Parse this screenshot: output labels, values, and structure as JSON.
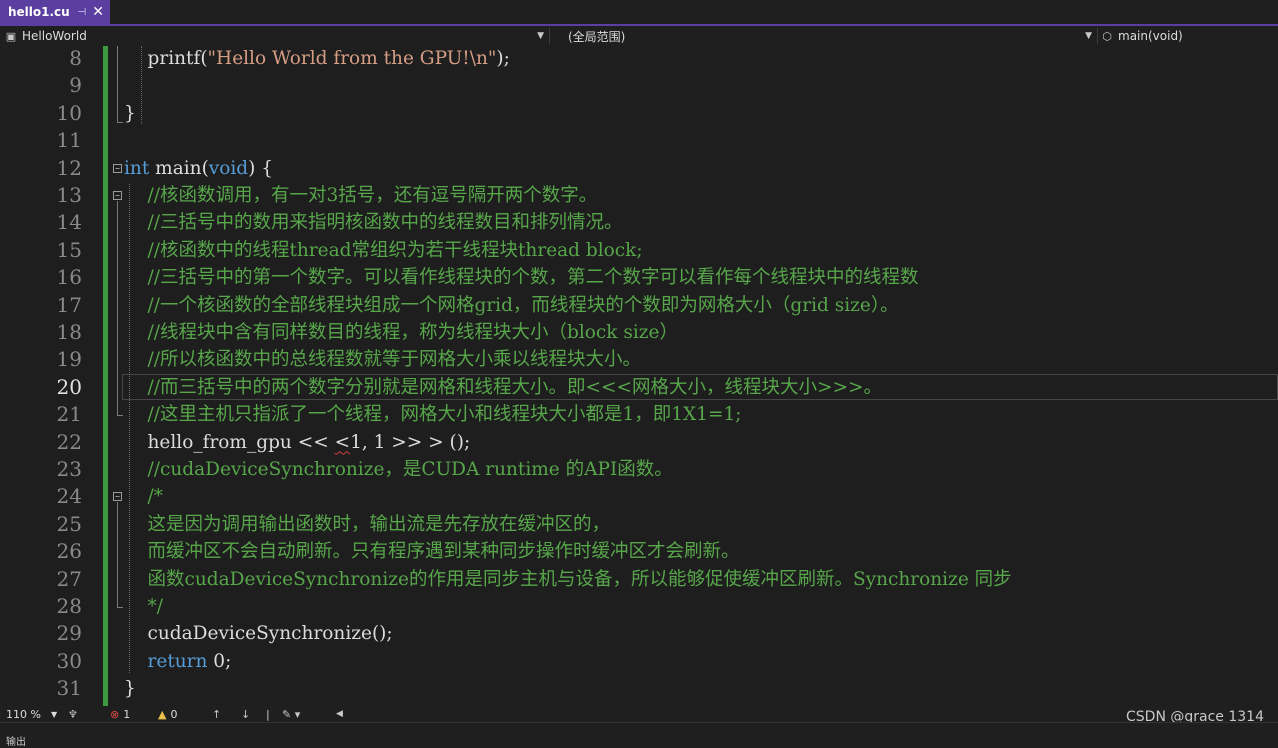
{
  "tab": {
    "title": "hello1.cu",
    "pin": "⊣",
    "close": "✕"
  },
  "navbar": {
    "project": "HelloWorld",
    "scope": "(全局范围)",
    "member": "main(void)",
    "project_icon": "project-icon",
    "member_icon": "cube-icon"
  },
  "current_line": 20,
  "code_lines": [
    {
      "n": "8",
      "segs": [
        [
          "plain",
          "    printf("
        ],
        [
          "str",
          "\"Hello World from the GPU!"
        ],
        [
          "esc",
          "\\n"
        ],
        [
          "str",
          "\""
        ],
        [
          "plain",
          ");"
        ]
      ]
    },
    {
      "n": "9",
      "segs": []
    },
    {
      "n": "10",
      "segs": [
        [
          "plain",
          "}"
        ]
      ]
    },
    {
      "n": "11",
      "segs": []
    },
    {
      "n": "12",
      "segs": [
        [
          "kw",
          "int"
        ],
        [
          "plain",
          " main("
        ],
        [
          "kw",
          "void"
        ],
        [
          "plain",
          ") {"
        ]
      ]
    },
    {
      "n": "13",
      "segs": [
        [
          "comment",
          "    //核函数调用，有一对3括号，还有逗号隔开两个数字。"
        ]
      ]
    },
    {
      "n": "14",
      "segs": [
        [
          "comment",
          "    //三括号中的数用来指明核函数中的线程数目和排列情况。"
        ]
      ]
    },
    {
      "n": "15",
      "segs": [
        [
          "comment",
          "    //核函数中的线程thread常组织为若干线程块thread block;"
        ]
      ]
    },
    {
      "n": "16",
      "segs": [
        [
          "comment",
          "    //三括号中的第一个数字。可以看作线程块的个数，第二个数字可以看作每个线程块中的线程数"
        ]
      ]
    },
    {
      "n": "17",
      "segs": [
        [
          "comment",
          "    //一个核函数的全部线程块组成一个网格grid，而线程块的个数即为网格大小（grid size）。"
        ]
      ]
    },
    {
      "n": "18",
      "segs": [
        [
          "comment",
          "    //线程块中含有同样数目的线程，称为线程块大小（block size）"
        ]
      ]
    },
    {
      "n": "19",
      "segs": [
        [
          "comment",
          "    //所以核函数中的总线程数就等于网格大小乘以线程块大小。"
        ]
      ]
    },
    {
      "n": "20",
      "segs": [
        [
          "comment",
          "    //而三括号中的两个数字分别就是网格和线程大小。即<<<网格大小，线程块大小>>>。"
        ]
      ]
    },
    {
      "n": "21",
      "segs": [
        [
          "comment",
          "    //这里主机只指派了一个线程，网格大小和线程块大小都是1，即1X1=1;"
        ]
      ]
    },
    {
      "n": "22",
      "segs": [
        [
          "plain",
          "    hello_from_gpu << "
        ],
        [
          "squig",
          "<"
        ],
        [
          "plain",
          "1, 1 >> > ();"
        ]
      ]
    },
    {
      "n": "23",
      "segs": [
        [
          "comment",
          "    //cudaDeviceSynchronize，是CUDA runtime 的API函数。"
        ]
      ]
    },
    {
      "n": "24",
      "segs": [
        [
          "comment",
          "    /*"
        ]
      ]
    },
    {
      "n": "25",
      "segs": [
        [
          "comment",
          "    这是因为调用输出函数时，输出流是先存放在缓冲区的，"
        ]
      ]
    },
    {
      "n": "26",
      "segs": [
        [
          "comment",
          "    而缓冲区不会自动刷新。只有程序遇到某种同步操作时缓冲区才会刷新。"
        ]
      ]
    },
    {
      "n": "27",
      "segs": [
        [
          "comment",
          "    函数cudaDeviceSynchronize的作用是同步主机与设备，所以能够促使缓冲区刷新。Synchronize 同步"
        ]
      ]
    },
    {
      "n": "28",
      "segs": [
        [
          "comment",
          "    */"
        ]
      ]
    },
    {
      "n": "29",
      "segs": [
        [
          "plain",
          "    cudaDeviceSynchronize();"
        ]
      ]
    },
    {
      "n": "30",
      "segs": [
        [
          "kw",
          "    return"
        ],
        [
          "plain",
          " 0;"
        ]
      ]
    },
    {
      "n": "31",
      "segs": [
        [
          "plain",
          "}"
        ]
      ]
    }
  ],
  "statusbar": {
    "zoom": "110 %",
    "errors": "1",
    "warnings": "0",
    "error_icon": "error-icon",
    "warning_icon": "warning-icon"
  },
  "watermark": "CSDN @grace 1314",
  "bottom_text": "输出",
  "colors": {
    "accent": "#5b3fa0",
    "comment": "#57a64a",
    "keyword": "#569cd6",
    "change_bar": "#3f9a3f"
  }
}
